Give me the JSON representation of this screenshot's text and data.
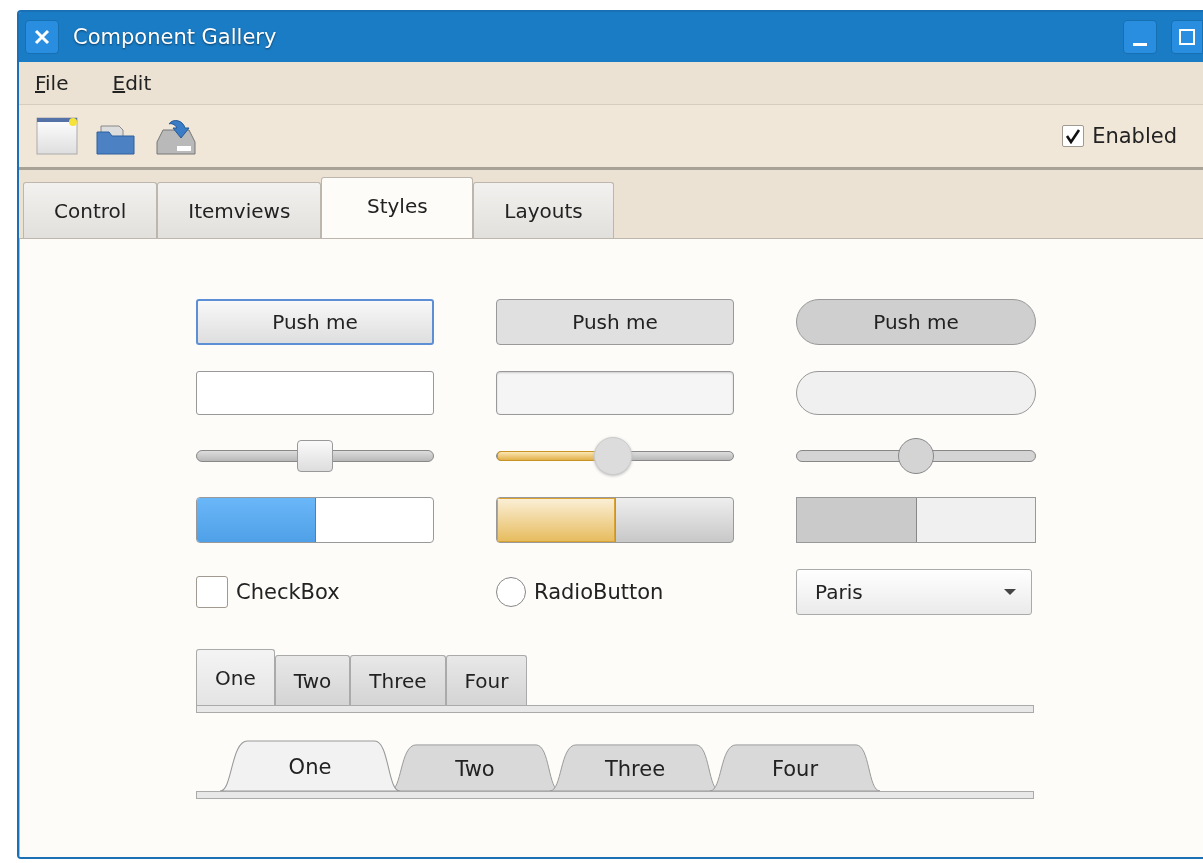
{
  "window": {
    "title": "Component Gallery"
  },
  "menu": [
    {
      "label": "File"
    },
    {
      "label": "Edit"
    }
  ],
  "toolbar": {
    "enabled": {
      "label": "Enabled",
      "checked": true
    }
  },
  "tabs": [
    {
      "label": "Control",
      "selected": false
    },
    {
      "label": "Itemviews",
      "selected": false
    },
    {
      "label": "Styles",
      "selected": true
    },
    {
      "label": "Layouts",
      "selected": false
    }
  ],
  "push_buttons": [
    {
      "label": "Push me",
      "kind": "focused"
    },
    {
      "label": "Push me",
      "kind": "plain"
    },
    {
      "label": "Push me",
      "kind": "round"
    }
  ],
  "text_fields": [
    {
      "kind": "focused"
    },
    {
      "kind": "plain"
    },
    {
      "kind": "round"
    }
  ],
  "sliders": [
    {
      "kind": "focused",
      "level": 0.5
    },
    {
      "kind": "plain",
      "level": 0.49
    },
    {
      "kind": "round",
      "level": 0.5
    }
  ],
  "progress_bars": [
    {
      "kind": "focused",
      "level": 0.5
    },
    {
      "kind": "plain",
      "level": 0.5
    },
    {
      "kind": "round",
      "level": 0.5
    }
  ],
  "checkbox": {
    "label": "CheckBox",
    "checked": false
  },
  "radio": {
    "label": "RadioButton",
    "selected": false
  },
  "combo": {
    "value": "Paris"
  },
  "tab_bars": [
    {
      "kind": "box",
      "tabs": [
        {
          "label": "One",
          "selected": true
        },
        {
          "label": "Two",
          "selected": false
        },
        {
          "label": "Three",
          "selected": false
        },
        {
          "label": "Four",
          "selected": false
        }
      ]
    },
    {
      "kind": "document",
      "tabs": [
        {
          "label": "One",
          "selected": true
        },
        {
          "label": "Two",
          "selected": false
        },
        {
          "label": "Three",
          "selected": false
        },
        {
          "label": "Four",
          "selected": false
        }
      ]
    }
  ]
}
